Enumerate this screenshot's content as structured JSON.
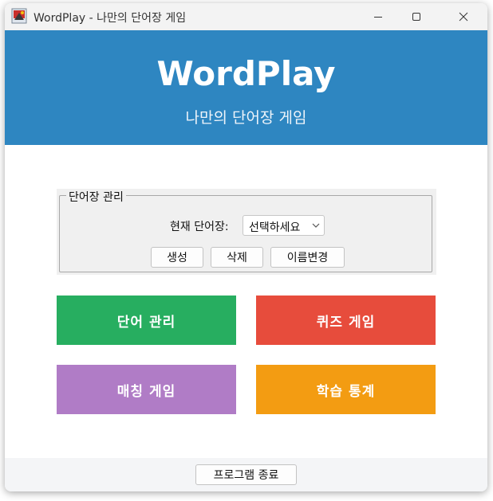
{
  "window": {
    "title": "WordPlay - 나만의 단어장 게임"
  },
  "header": {
    "app_name": "WordPlay",
    "subtitle": "나만의 단어장 게임",
    "background": "#2e86c1"
  },
  "vocab_group": {
    "legend": "단어장 관리",
    "current_label": "현재 단어장:",
    "select_value": "선택하세요",
    "buttons": {
      "create": "생성",
      "delete": "삭제",
      "rename": "이름변경"
    }
  },
  "menu": [
    {
      "label": "단어 관리",
      "color": "#27ae60"
    },
    {
      "label": "퀴즈 게임",
      "color": "#e74c3c"
    },
    {
      "label": "매칭 게임",
      "color": "#b07cc6"
    },
    {
      "label": "학습 통계",
      "color": "#f39c12"
    }
  ],
  "footer": {
    "exit_label": "프로그램 종료"
  }
}
